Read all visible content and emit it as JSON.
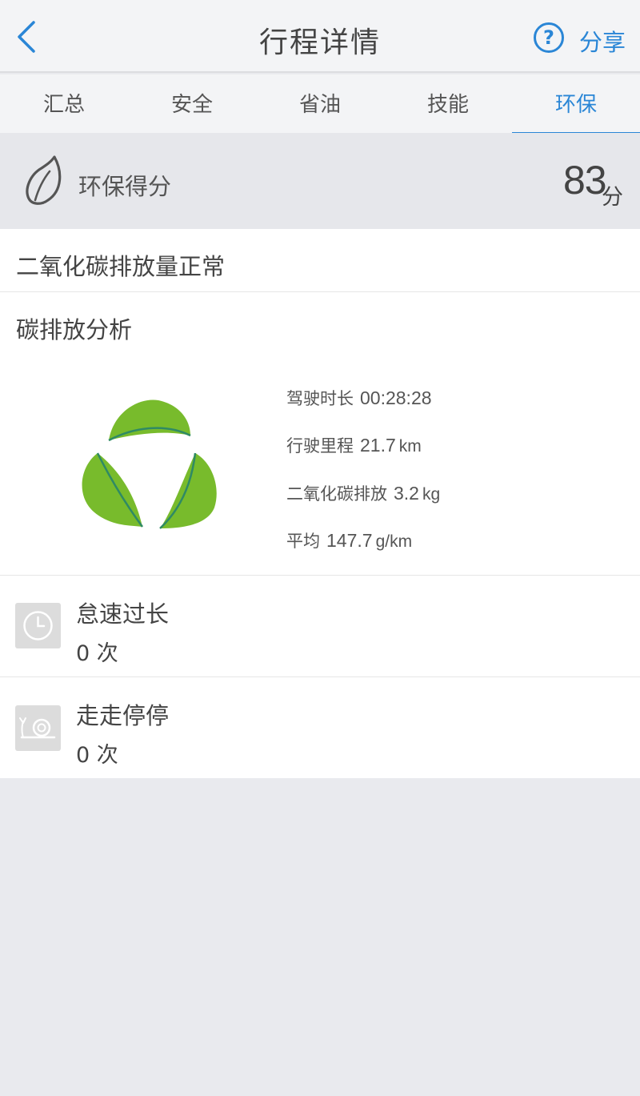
{
  "header": {
    "title": "行程详情",
    "help_glyph": "?",
    "share_label": "分享",
    "back_icon": "chevron-left-icon",
    "accent_color": "#2a86d6"
  },
  "tabs": [
    {
      "label": "汇总",
      "active": false
    },
    {
      "label": "安全",
      "active": false
    },
    {
      "label": "省油",
      "active": false
    },
    {
      "label": "技能",
      "active": false
    },
    {
      "label": "环保",
      "active": true
    }
  ],
  "score": {
    "label": "环保得分",
    "value": "83",
    "unit": "分",
    "icon": "leaf-icon"
  },
  "status": {
    "text": "二氧化碳排放量正常"
  },
  "analysis": {
    "title": "碳排放分析",
    "icon": "recycle-leaves-icon",
    "stats": [
      {
        "label": "驾驶时长",
        "value": "00:28:28",
        "unit": ""
      },
      {
        "label": "行驶里程",
        "value": "21.7",
        "unit": "km"
      },
      {
        "label": "二氧化碳排放",
        "value": "3.2",
        "unit": "kg"
      },
      {
        "label": "平均",
        "value": "147.7",
        "unit": "g/km"
      }
    ]
  },
  "items": [
    {
      "title": "怠速过长",
      "count": "0 次",
      "icon": "clock-icon"
    },
    {
      "title": "走走停停",
      "count": "0 次",
      "icon": "snail-icon"
    }
  ]
}
